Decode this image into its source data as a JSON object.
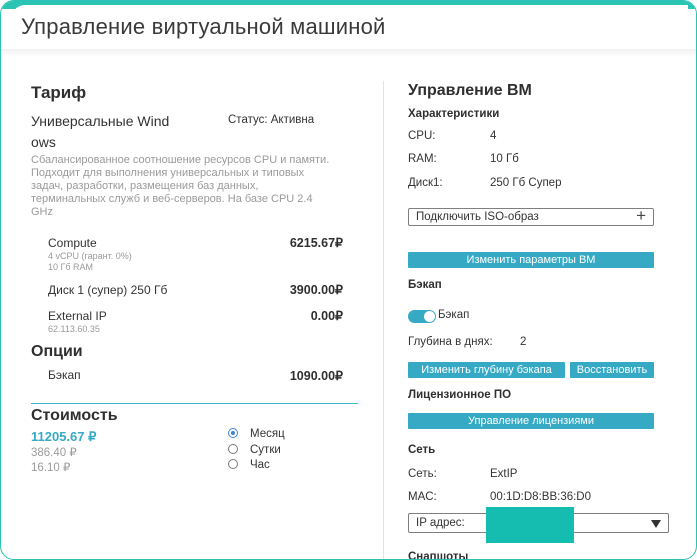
{
  "title": "Управление виртуальной машиной",
  "tariff": {
    "heading": "Тариф",
    "name_line1": "Универсальные Wind",
    "name_line2": "ows",
    "status": "Статус: Активна",
    "description": [
      "Сбалансированное соотношение ресурсов CPU и памяти.",
      "Подходит для выполнения универсальных и типовых",
      "задач, разработки, размещения баз данных,",
      "терминальных служб и веб-серверов. На базе CPU 2.4",
      "GHz"
    ],
    "items": [
      {
        "name": "Compute",
        "detail1": "4 vCPU (гарант. 0%)",
        "detail2": "10 Гб RAM",
        "price": "6215.67₽"
      },
      {
        "name": "Диск 1 (супер) 250 Гб",
        "price": "3900.00₽"
      },
      {
        "name": "External IP",
        "detail1": "62.113.60.35",
        "price": "0.00₽"
      }
    ]
  },
  "options": {
    "heading": "Опции",
    "items": [
      {
        "name": "Бэкап",
        "price": "1090.00₽"
      }
    ]
  },
  "cost": {
    "heading": "Стоимость",
    "month": "11205.67 ₽",
    "day": "386.40 ₽",
    "hour": "16.10 ₽",
    "periods": [
      {
        "label": "Месяц",
        "selected": true
      },
      {
        "label": "Сутки",
        "selected": false
      },
      {
        "label": "Час",
        "selected": false
      }
    ]
  },
  "vm": {
    "heading": "Управление ВМ",
    "specs_heading": "Характеристики",
    "specs": [
      {
        "label": "CPU:",
        "value": "4"
      },
      {
        "label": "RAM:",
        "value": "10 Гб"
      },
      {
        "label": "Диск1:",
        "value": "250 Гб Супер"
      }
    ],
    "iso_button": "Подключить ISO-образ",
    "change_params_button": "Изменить параметры ВМ",
    "backup_heading": "Бэкап",
    "backup_toggle_label": "Бэкап",
    "backup_toggle_on": true,
    "depth_label": "Глубина в днях:",
    "depth_value": "2",
    "change_depth_button": "Изменить глубину бэкапа",
    "restore_button": "Восстановить",
    "license_heading": "Лицензионное ПО",
    "license_button": "Управление лицензиями",
    "network_heading": "Сеть",
    "network_label": "Сеть:",
    "network_value": "ExtIP",
    "mac_label": "MAC:",
    "mac_value": "00:1D:D8:BB:36:D0",
    "ip_label": "IP адрес:",
    "snapshots_heading": "Снапшоты"
  },
  "colors": {
    "accent": "#36a9c4",
    "frame": "#2bc3b4"
  }
}
